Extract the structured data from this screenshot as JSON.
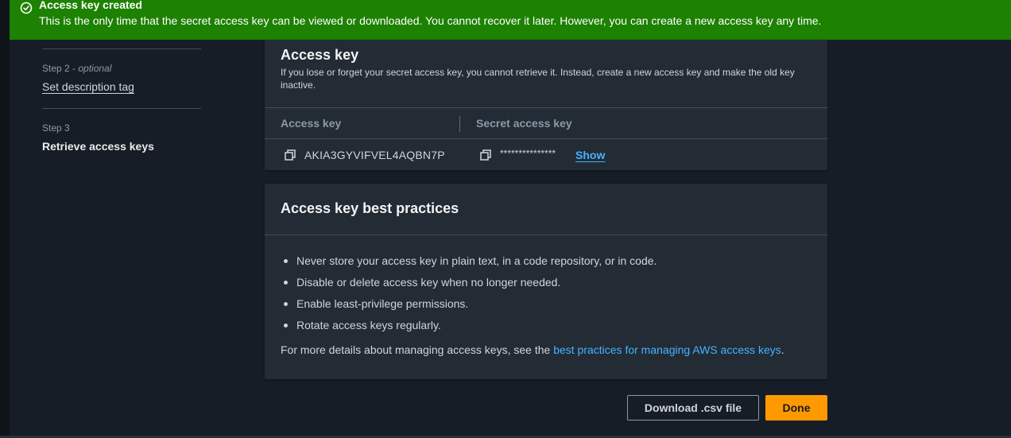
{
  "flash": {
    "icon": "success-check-icon",
    "title": "Access key created",
    "message": "This is the only time that the secret access key can be viewed or downloaded. You cannot recover it later. However, you can create a new access key any time."
  },
  "steps": [
    {
      "step": "Step 2",
      "qualifier": "optional",
      "label": "Set description tag"
    },
    {
      "step": "Step 3",
      "label": "Retrieve access keys"
    }
  ],
  "access_key_card": {
    "title": "Access key",
    "description": "If you lose or forget your secret access key, you cannot retrieve it. Instead, create a new access key and make the old key inactive.",
    "columns": [
      "Access key",
      "Secret access key"
    ],
    "access_key_id": "AKIA3GYVIFVEL4AQBN7P",
    "secret_masked": "***************",
    "show_label": "Show"
  },
  "best_practices": {
    "title": "Access key best practices",
    "items": [
      "Never store your access key in plain text, in a code repository, or in code.",
      "Disable or delete access key when no longer needed.",
      "Enable least-privilege permissions.",
      "Rotate access keys regularly."
    ],
    "more_prefix": "For more details about managing access keys, see the ",
    "more_link": "best practices for managing AWS access keys",
    "more_suffix": "."
  },
  "buttons": {
    "download": "Download .csv file",
    "done": "Done"
  },
  "colors": {
    "success_banner": "#1d8102",
    "primary_button": "#ff9900",
    "link": "#42b4ff",
    "card_bg": "#232b35",
    "page_bg": "#161d26"
  }
}
